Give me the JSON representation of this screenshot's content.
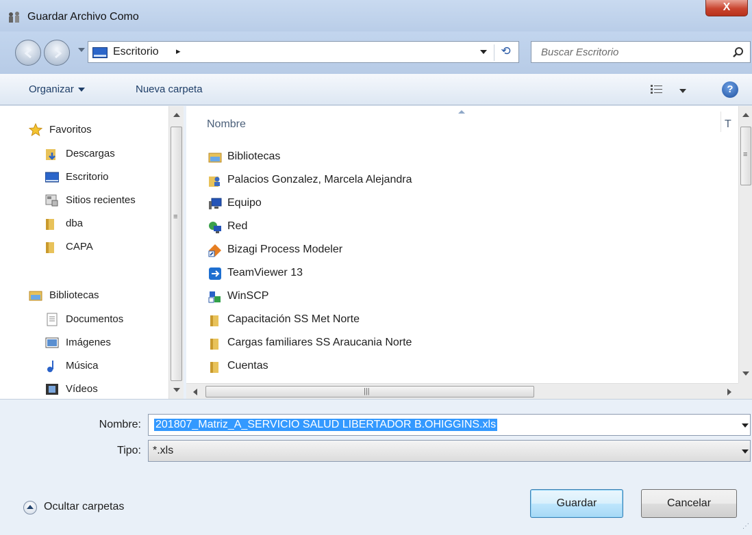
{
  "window": {
    "title": "Guardar Archivo Como",
    "close_label": "X"
  },
  "address_bar": {
    "location": "Escritorio",
    "chevron": "▸",
    "refresh_glyph": "⟲"
  },
  "search": {
    "placeholder": "Buscar Escritorio"
  },
  "toolbar": {
    "organize_label": "Organizar",
    "new_folder_label": "Nueva carpeta",
    "help_label": "?"
  },
  "nav_pane": {
    "groups": [
      {
        "label": "Favoritos",
        "icon": "star-icon",
        "items": [
          {
            "label": "Descargas",
            "icon": "downloads-folder-icon"
          },
          {
            "label": "Escritorio",
            "icon": "desktop-icon"
          },
          {
            "label": "Sitios recientes",
            "icon": "recent-places-icon"
          },
          {
            "label": "dba",
            "icon": "folder-icon"
          },
          {
            "label": "CAPA",
            "icon": "folder-icon"
          }
        ]
      },
      {
        "label": "Bibliotecas",
        "icon": "libraries-icon",
        "items": [
          {
            "label": "Documentos",
            "icon": "documents-icon"
          },
          {
            "label": "Imágenes",
            "icon": "pictures-icon"
          },
          {
            "label": "Música",
            "icon": "music-icon"
          },
          {
            "label": "Vídeos",
            "icon": "videos-icon"
          }
        ]
      }
    ]
  },
  "file_list": {
    "columns": [
      "Nombre",
      "T"
    ],
    "items": [
      {
        "name": "Bibliotecas",
        "icon": "libraries-icon"
      },
      {
        "name": "Palacios Gonzalez, Marcela Alejandra",
        "icon": "user-folder-icon"
      },
      {
        "name": "Equipo",
        "icon": "computer-icon"
      },
      {
        "name": "Red",
        "icon": "network-icon"
      },
      {
        "name": "Bizagi Process Modeler",
        "icon": "bizagi-shortcut-icon"
      },
      {
        "name": "TeamViewer 13",
        "icon": "teamviewer-shortcut-icon"
      },
      {
        "name": "WinSCP",
        "icon": "winscp-shortcut-icon"
      },
      {
        "name": "Capacitación SS Met Norte",
        "icon": "folder-icon"
      },
      {
        "name": "Cargas familiares SS Araucania Norte",
        "icon": "folder-icon"
      },
      {
        "name": "Cuentas",
        "icon": "folder-icon"
      }
    ]
  },
  "form": {
    "filename_label": "Nombre:",
    "filename_value": "201807_Matriz_A_SERVICIO SALUD LIBERTADOR B.OHIGGINS.xls",
    "type_label": "Tipo:",
    "type_value": "*.xls",
    "hide_folders_label": "Ocultar carpetas",
    "save_label": "Guardar",
    "cancel_label": "Cancelar"
  },
  "colors": {
    "selection": "#3399ff",
    "folder": "#e8c25a",
    "link_text": "#1e3e68"
  }
}
